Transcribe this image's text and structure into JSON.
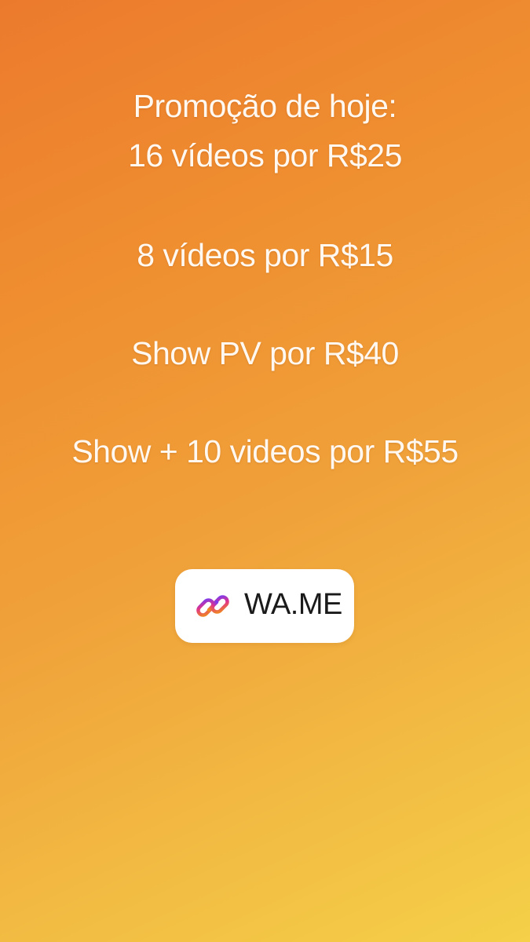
{
  "story": {
    "lines": [
      "Promoção de hoje:",
      "16 vídeos por R$25",
      "8 vídeos por R$15",
      "Show PV por R$40",
      "Show + 10 videos por R$55"
    ]
  },
  "link_sticker": {
    "label": "WA.ME",
    "icon": "link-icon",
    "icon_gradient": [
      "#f08a1e",
      "#e0338a",
      "#7c3aed"
    ]
  },
  "background": {
    "gradient_colors": [
      "#ec7a2d",
      "#f0a23a",
      "#f5d048"
    ]
  }
}
